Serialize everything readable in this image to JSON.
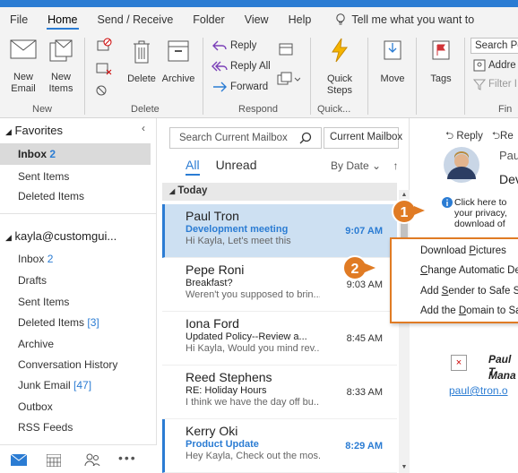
{
  "ribbon_tabs": [
    "File",
    "Home",
    "Send / Receive",
    "Folder",
    "View",
    "Help"
  ],
  "tell_me": "Tell me what you want to",
  "ribbon": {
    "new_email": "New Email",
    "new_items": "New Items",
    "delete": "Delete",
    "archive": "Archive",
    "reply": "Reply",
    "reply_all": "Reply All",
    "forward": "Forward",
    "quick_steps": "Quick Steps",
    "move": "Move",
    "tags": "Tags",
    "search_people": "Search Pe",
    "address_book": "Addre",
    "filter_email": "Filter I",
    "groups": {
      "new": "New",
      "delete": "Delete",
      "respond": "Respond",
      "quick": "Quick...",
      "find": "Fin"
    }
  },
  "folders": {
    "favorites_label": "Favorites",
    "fav_items": [
      {
        "label": "Inbox",
        "count": "2"
      },
      {
        "label": "Sent Items",
        "count": ""
      },
      {
        "label": "Deleted Items",
        "count": ""
      }
    ],
    "account": "kayla@customgui...",
    "account_items": [
      {
        "label": "Inbox",
        "count": "2"
      },
      {
        "label": "Drafts",
        "count": ""
      },
      {
        "label": "Sent Items",
        "count": ""
      },
      {
        "label": "Deleted Items",
        "count": "[3]"
      },
      {
        "label": "Archive",
        "count": ""
      },
      {
        "label": "Conversation History",
        "count": ""
      },
      {
        "label": "Junk Email",
        "count": "[47]"
      },
      {
        "label": "Outbox",
        "count": ""
      },
      {
        "label": "RSS Feeds",
        "count": ""
      }
    ]
  },
  "mail": {
    "search_placeholder": "Search Current Mailbox",
    "scope": "Current Mailbox",
    "filter_all": "All",
    "filter_unread": "Unread",
    "sort": "By Date",
    "group_today": "Today",
    "messages": [
      {
        "from": "Paul Tron",
        "subject": "Development meeting",
        "preview": "Hi Kayla, Let's meet this",
        "time": "9:07 AM"
      },
      {
        "from": "Pepe Roni",
        "subject": "Breakfast?",
        "preview": "Weren't you supposed to brin...",
        "time": "9:03 AM"
      },
      {
        "from": "Iona Ford",
        "subject": "Updated Policy--Review a...",
        "preview": "Hi Kayla, Would you mind rev...",
        "time": "8:45 AM"
      },
      {
        "from": "Reed Stephens",
        "subject": "RE: Holiday Hours",
        "preview": "I think we have the day off bu...",
        "time": "8:33 AM"
      },
      {
        "from": "Kerry Oki",
        "subject": "Product Update",
        "preview": "Hey Kayla, Check out the mos...",
        "time": "8:29 AM"
      }
    ]
  },
  "reading": {
    "reply": "Reply",
    "reply_all_short": "Re",
    "sender_short": "Pau",
    "subject_short": "Dev",
    "info_lines": [
      "Click here to",
      "your privacy,",
      "download of"
    ],
    "sig_name": "Paul T",
    "sig_title": "Mana",
    "sig_email": "paul@tron.o"
  },
  "context_menu": {
    "items": [
      {
        "label": "Download Pictures",
        "key": "P"
      },
      {
        "label": "Change Automatic De",
        "key": "C"
      },
      {
        "label": "Add Sender to Safe Se",
        "key": "S"
      },
      {
        "label": "Add the Domain to Sa",
        "key": "D"
      }
    ]
  },
  "callouts": [
    "1",
    "2"
  ],
  "colors": {
    "accent": "#2b7cd3",
    "callout": "#e07b24"
  }
}
